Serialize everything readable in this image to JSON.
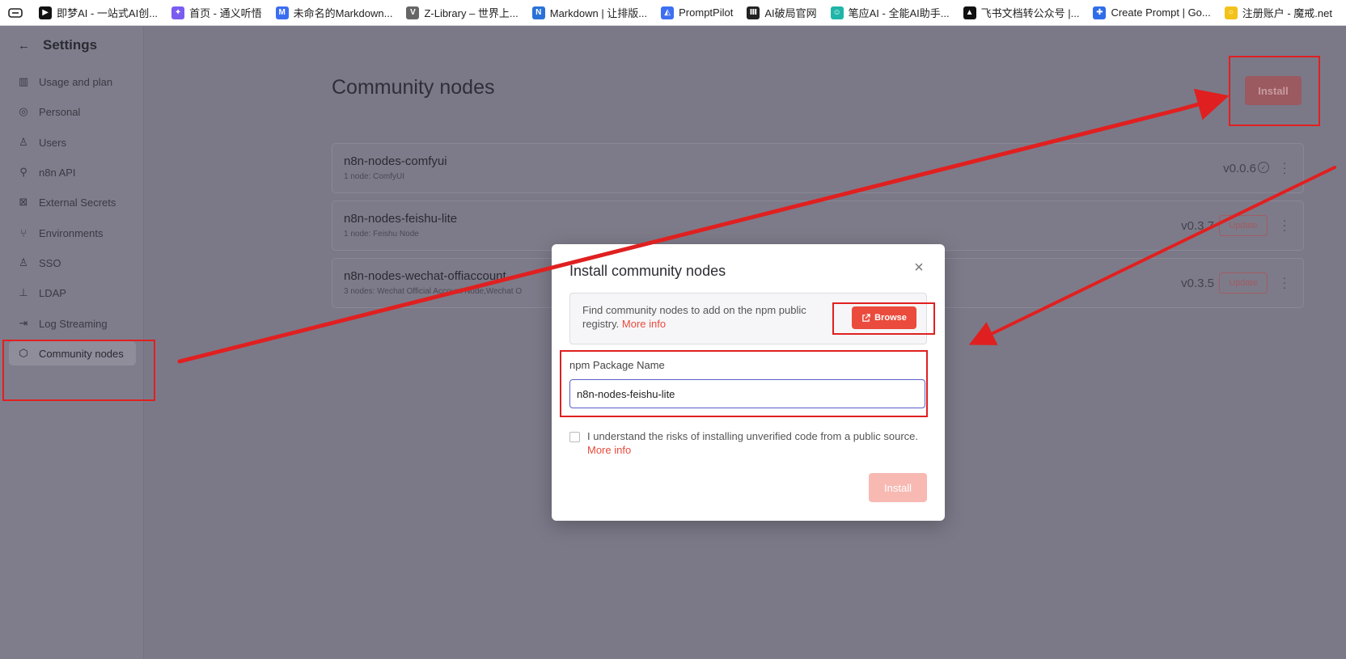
{
  "bookmarks": [
    {
      "label": "即梦AI - 一站式AI创...",
      "icon": "jimeng-icon",
      "color": "#111111",
      "glyph": "▶"
    },
    {
      "label": "首页 - 通义听悟",
      "icon": "tongyi-icon",
      "color": "#7a5cf0",
      "glyph": "✦"
    },
    {
      "label": "未命名的Markdown...",
      "icon": "markdown-editor-icon",
      "color": "#3b6df0",
      "glyph": "M"
    },
    {
      "label": "Z-Library – 世界上...",
      "icon": "zlibrary-icon",
      "color": "#666666",
      "glyph": "V"
    },
    {
      "label": "Markdown | 让排版...",
      "icon": "markdown-nice-icon",
      "color": "#2a72d8",
      "glyph": "N"
    },
    {
      "label": "PromptPilot",
      "icon": "promptpilot-icon",
      "color": "#3d6ff2",
      "glyph": "◭"
    },
    {
      "label": "AI破局官网",
      "icon": "aipoju-icon",
      "color": "#222222",
      "glyph": "Ⅲ"
    },
    {
      "label": "笔应AI - 全能AI助手...",
      "icon": "biying-icon",
      "color": "#20b5a8",
      "glyph": "☺"
    },
    {
      "label": "飞书文档转公众号 |...",
      "icon": "feishu-icon",
      "color": "#111111",
      "glyph": "▲"
    },
    {
      "label": "Create Prompt | Go...",
      "icon": "create-prompt-icon",
      "color": "#2f6ee8",
      "glyph": "✚"
    },
    {
      "label": "注册账户 - 魔戒.net",
      "icon": "mojie-icon",
      "color": "#f3c21a",
      "glyph": "○"
    }
  ],
  "sidebar": {
    "title": "Settings",
    "items": [
      {
        "label": "Usage and plan",
        "icon": "chart-icon",
        "glyph": "▥",
        "active": false
      },
      {
        "label": "Personal",
        "icon": "user-circle-icon",
        "glyph": "◎",
        "active": false
      },
      {
        "label": "Users",
        "icon": "user-icon",
        "glyph": "♙",
        "active": false
      },
      {
        "label": "n8n API",
        "icon": "plug-icon",
        "glyph": "⚲",
        "active": false
      },
      {
        "label": "External Secrets",
        "icon": "vault-icon",
        "glyph": "⊠",
        "active": false
      },
      {
        "label": "Environments",
        "icon": "branch-icon",
        "glyph": "⑂",
        "active": false
      },
      {
        "label": "SSO",
        "icon": "user-lock-icon",
        "glyph": "♙",
        "active": false
      },
      {
        "label": "LDAP",
        "icon": "network-icon",
        "glyph": "⊥",
        "active": false
      },
      {
        "label": "Log Streaming",
        "icon": "log-in-icon",
        "glyph": "⇥",
        "active": false
      },
      {
        "label": "Community nodes",
        "icon": "cube-icon",
        "glyph": "⬡",
        "active": true
      }
    ]
  },
  "main": {
    "title": "Community nodes",
    "install_label": "Install",
    "nodes": [
      {
        "name": "n8n-nodes-comfyui",
        "sub": "1 node:  ComfyUI",
        "version": "v0.0.6",
        "status": "up-to-date"
      },
      {
        "name": "n8n-nodes-feishu-lite",
        "sub": "1 node:  Feishu Node",
        "version": "v0.3.7",
        "status": "update",
        "update_label": "Update"
      },
      {
        "name": "n8n-nodes-wechat-offiaccount",
        "sub": "3 nodes:  Wechat Official Account Node,Wechat O",
        "version": "v0.3.5",
        "status": "update",
        "update_label": "Update"
      }
    ]
  },
  "modal": {
    "title": "Install community nodes",
    "info_text": "Find community nodes to add on the npm public registry.",
    "info_link": "More info",
    "browse_label": "Browse",
    "field_label": "npm Package Name",
    "field_value": "n8n-nodes-feishu-lite",
    "checkbox_text": "I understand the risks of installing unverified code from a public source.",
    "checkbox_link": "More info",
    "install_label": "Install"
  },
  "colors": {
    "accent": "#ea4b3c",
    "annotation": "#e02020",
    "overlay": "#7b7988"
  }
}
